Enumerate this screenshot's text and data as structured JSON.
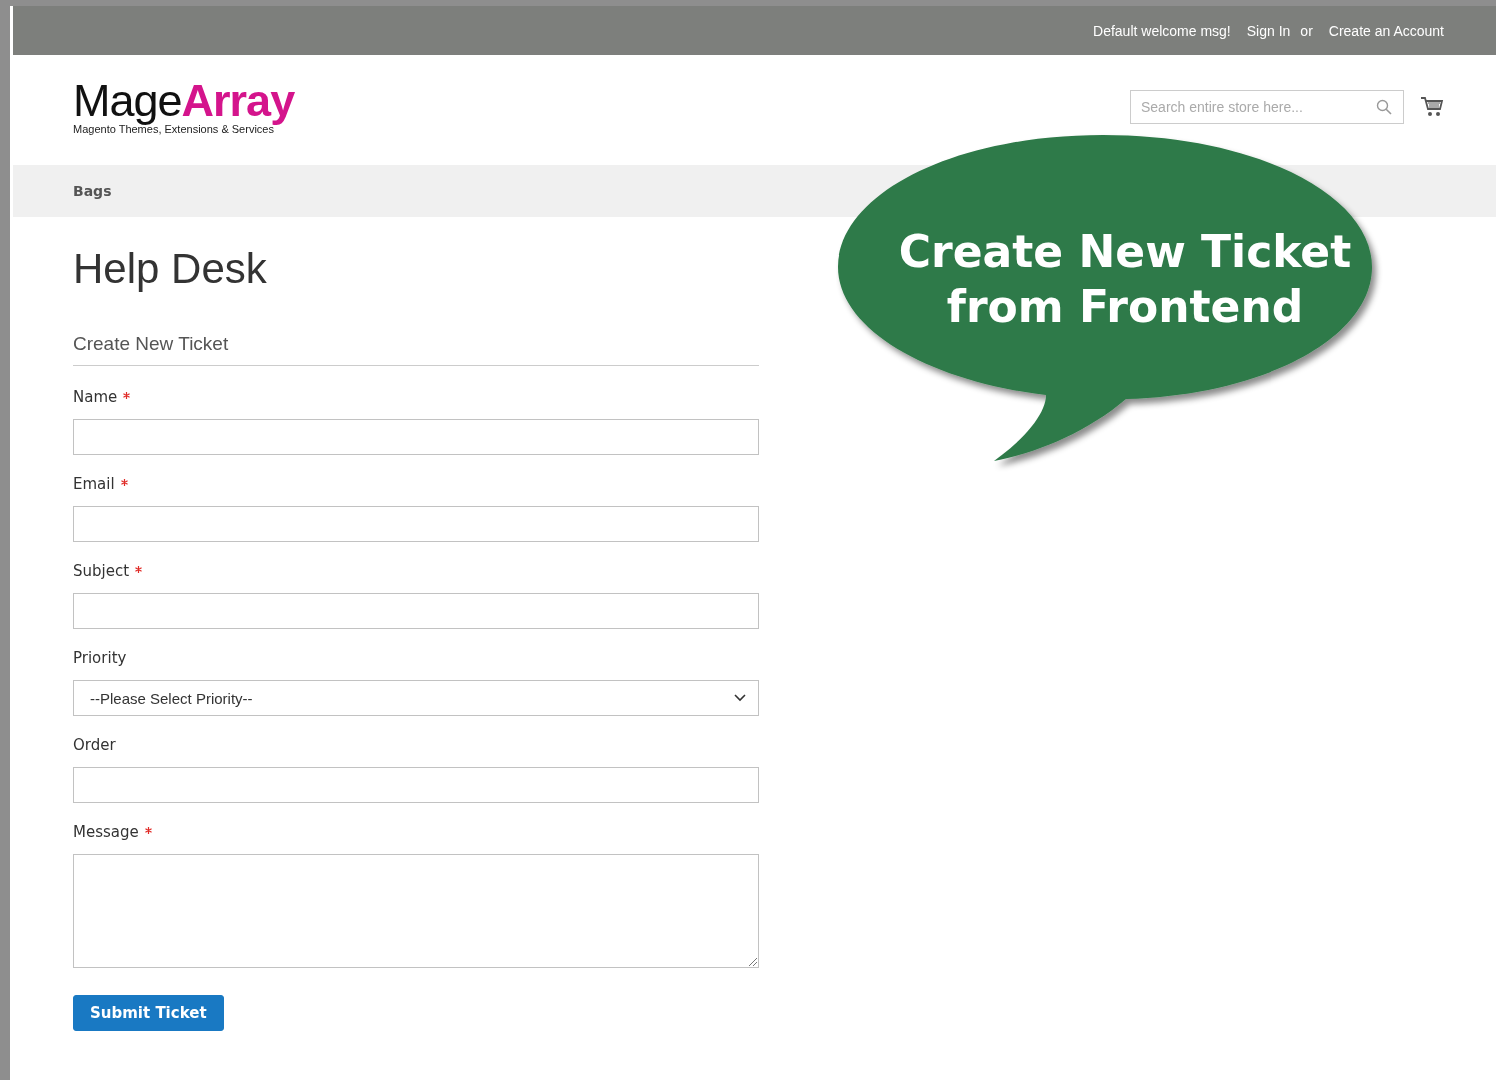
{
  "top_bar": {
    "welcome": "Default welcome msg!",
    "sign_in": "Sign In",
    "or": "or",
    "create_account": "Create an Account"
  },
  "header": {
    "logo": {
      "part_1": "Mage",
      "part_2": "Array",
      "tagline": "Magento Themes, Extensions & Services"
    },
    "search": {
      "placeholder": "Search entire store here..."
    }
  },
  "nav": {
    "items": [
      "Bags"
    ]
  },
  "page_title": "Help Desk",
  "form": {
    "title": "Create New Ticket",
    "fields": [
      {
        "kind": "text",
        "label": "Name",
        "required": true
      },
      {
        "kind": "text",
        "label": "Email",
        "required": true
      },
      {
        "kind": "text",
        "label": "Subject",
        "required": true
      },
      {
        "kind": "select",
        "label": "Priority",
        "required": false,
        "value": "--Please Select Priority--"
      },
      {
        "kind": "text",
        "label": "Order",
        "required": false
      },
      {
        "kind": "textarea",
        "label": "Message",
        "required": true
      }
    ],
    "submit": "Submit Ticket"
  },
  "callout": {
    "lines": [
      "Create New Ticket",
      "from Frontend"
    ]
  }
}
